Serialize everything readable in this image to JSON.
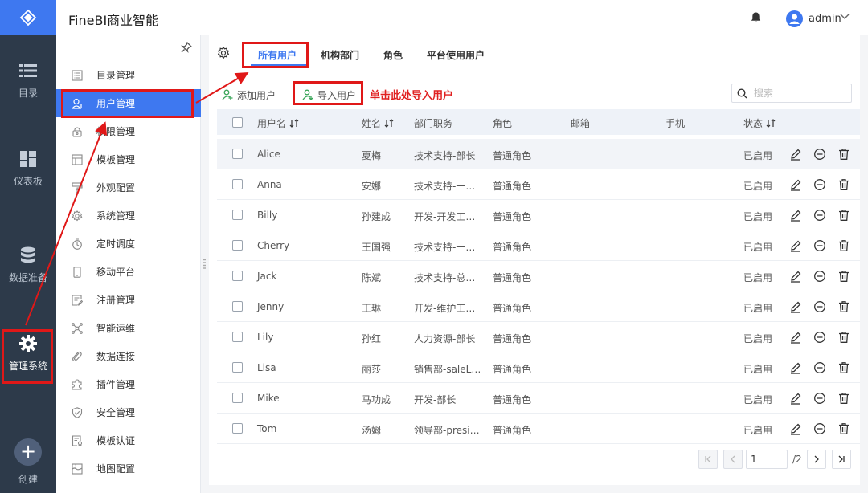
{
  "header": {
    "title": "FineBI商业智能",
    "user_name": "admin"
  },
  "rail": {
    "items": [
      {
        "label": "目录"
      },
      {
        "label": "仪表板"
      },
      {
        "label": "数据准备"
      },
      {
        "label": "管理系统"
      },
      {
        "label": "创建"
      }
    ]
  },
  "submenu": {
    "items": [
      {
        "label": "目录管理"
      },
      {
        "label": "用户管理"
      },
      {
        "label": "权限管理"
      },
      {
        "label": "模板管理"
      },
      {
        "label": "外观配置"
      },
      {
        "label": "系统管理"
      },
      {
        "label": "定时调度"
      },
      {
        "label": "移动平台"
      },
      {
        "label": "注册管理"
      },
      {
        "label": "智能运维"
      },
      {
        "label": "数据连接"
      },
      {
        "label": "插件管理"
      },
      {
        "label": "安全管理"
      },
      {
        "label": "模板认证"
      },
      {
        "label": "地图配置"
      }
    ]
  },
  "tabs": [
    {
      "label": "所有用户"
    },
    {
      "label": "机构部门"
    },
    {
      "label": "角色"
    },
    {
      "label": "平台使用用户"
    }
  ],
  "toolbar": {
    "add_user": "添加用户",
    "import_user": "导入用户",
    "hint": "单击此处导入用户",
    "search_placeholder": "搜索"
  },
  "table": {
    "columns": [
      "用户名",
      "姓名",
      "部门职务",
      "角色",
      "邮箱",
      "手机",
      "状态"
    ],
    "rows": [
      {
        "username": "Alice",
        "name": "夏梅",
        "dept": "技术支持-部长",
        "role": "普通角色",
        "email": "",
        "phone": "",
        "status": "已启用"
      },
      {
        "username": "Anna",
        "name": "安娜",
        "dept": "技术支持-一…",
        "role": "普通角色",
        "email": "",
        "phone": "",
        "status": "已启用"
      },
      {
        "username": "Billy",
        "name": "孙建成",
        "dept": "开发-开发工…",
        "role": "普通角色",
        "email": "",
        "phone": "",
        "status": "已启用"
      },
      {
        "username": "Cherry",
        "name": "王国强",
        "dept": "技术支持-一…",
        "role": "普通角色",
        "email": "",
        "phone": "",
        "status": "已启用"
      },
      {
        "username": "Jack",
        "name": "陈斌",
        "dept": "技术支持-总…",
        "role": "普通角色",
        "email": "",
        "phone": "",
        "status": "已启用"
      },
      {
        "username": "Jenny",
        "name": "王琳",
        "dept": "开发-维护工…",
        "role": "普通角色",
        "email": "",
        "phone": "",
        "status": "已启用"
      },
      {
        "username": "Lily",
        "name": "孙红",
        "dept": "人力资源-部长",
        "role": "普通角色",
        "email": "",
        "phone": "",
        "status": "已启用"
      },
      {
        "username": "Lisa",
        "name": "丽莎",
        "dept": "销售部-saleL…",
        "role": "普通角色",
        "email": "",
        "phone": "",
        "status": "已启用"
      },
      {
        "username": "Mike",
        "name": "马功成",
        "dept": "开发-部长",
        "role": "普通角色",
        "email": "",
        "phone": "",
        "status": "已启用"
      },
      {
        "username": "Tom",
        "name": "汤姆",
        "dept": "领导部-presi…",
        "role": "普通角色",
        "email": "",
        "phone": "",
        "status": "已启用"
      }
    ]
  },
  "pager": {
    "current": "1",
    "total": "/2"
  },
  "colors": {
    "accent": "#3e78f0",
    "rail_bg": "#2d3a4a",
    "annotation": "#e01818"
  }
}
